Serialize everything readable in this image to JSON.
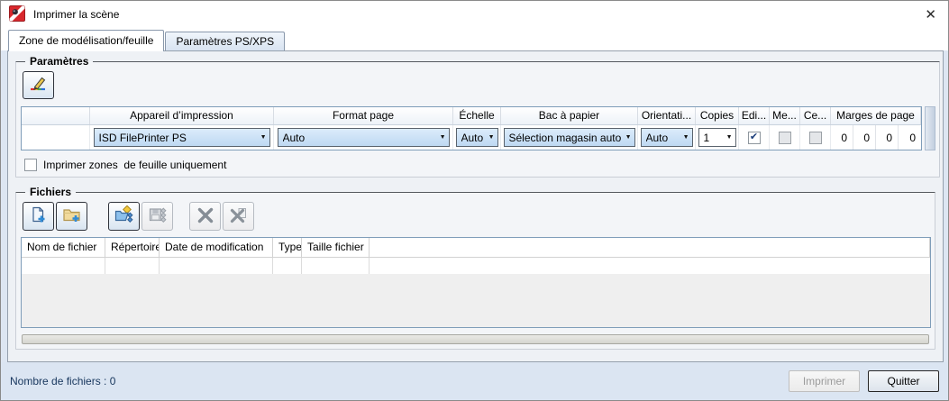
{
  "window": {
    "title": "Imprimer la scène"
  },
  "icons": {
    "close": "✕",
    "dropdown_arrow": "▼",
    "check": "✔"
  },
  "tabs": {
    "tab1": "Zone de modélisation/feuille",
    "tab2": "Paramètres PS/XPS"
  },
  "parametres": {
    "label": "Paramètres",
    "headers": {
      "device": "Appareil d’impression",
      "format": "Format page",
      "scale": "Échelle",
      "tray": "Bac à papier",
      "orientation": "Orientati...",
      "copies": "Copies",
      "edi": "Edi...",
      "me": "Me...",
      "ce": "Ce...",
      "margins": "Marges de page"
    },
    "row": {
      "device": "ISD FilePrinter PS",
      "format": "Auto",
      "scale": "Auto",
      "tray": "Sélection magasin auto",
      "orientation": "Auto",
      "copies": "1",
      "edi_checked": true,
      "me_checked": false,
      "ce_checked": false,
      "margins": [
        "0",
        "0",
        "0",
        "0"
      ]
    },
    "print_zones_checkbox": "Imprimer zones  de feuille uniquement"
  },
  "fichiers": {
    "label": "Fichiers",
    "toolbar": [
      "add-file",
      "add-folder",
      "generate-files",
      "save-files",
      "delete-file",
      "delete-all-files"
    ],
    "headers": {
      "name": "Nom de fichier",
      "directory": "Répertoire",
      "modified": "Date de modification",
      "type": "Type",
      "size": "Taille fichier"
    },
    "rows": []
  },
  "footer": {
    "count": "Nombre de fichiers : 0",
    "print": "Imprimer",
    "quit": "Quitter"
  }
}
